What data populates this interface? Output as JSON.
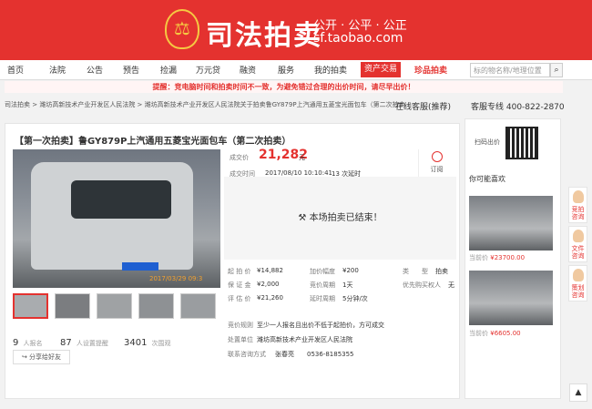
{
  "header": {
    "emblem_glyph": "⚖",
    "logo_text": "司法拍卖",
    "slogan": "公开 · 公平 · 公正",
    "url": "sf.taobao.com",
    "colors": {
      "brand_red": "#e4322f",
      "emblem_gold": "#f5c842"
    }
  },
  "nav": {
    "items": [
      "首页",
      "法院",
      "公告",
      "预告",
      "捡漏",
      "万元贷",
      "融资",
      "服务",
      "我的拍卖"
    ],
    "hot_item": "资产交易",
    "treasure_item": "珍品拍卖",
    "search_placeholder": "标的物名称/地理位置",
    "search_icon": "search-icon"
  },
  "notice": "提醒：竞电脑时间和拍卖时间不一致，为避免错过合理的出价时间，请尽早出价！",
  "breadcrumb": {
    "path": "司法拍卖 > 潍坊高新技术产业开发区人民法院 > 潍坊高新技术产业开发区人民法院关于拍卖鲁GY879P上汽通用五菱宝光面包车（第二次拍卖）（第一",
    "kefu": "在线客服(推荐)",
    "hotline": "客服专线 400-822-2870"
  },
  "item": {
    "title": "【第一次拍卖】鲁GY879P上汽通用五菱宝光面包车（第二次拍卖）",
    "photo_date": "2017/03/29 09:3",
    "price_label": "成交价",
    "price": "21,282",
    "price_unit": "元",
    "time_label": "成交时间",
    "time_value": "2017/08/10 10:10:41",
    "bids": "13 次延时",
    "remind_label": "订阅",
    "ended_text": "本场拍卖已结束！",
    "details": [
      {
        "label": "起 拍 价",
        "value": "¥14,882"
      },
      {
        "label": "加价幅度",
        "value": "¥200"
      },
      {
        "label": "类　　型",
        "value": "拍卖"
      },
      {
        "label": "保 证 金",
        "value": "¥2,000"
      },
      {
        "label": "竞价周期",
        "value": "1天"
      },
      {
        "label": "优先购买权人",
        "value": "无"
      },
      {
        "label": "评 估 价",
        "value": "¥21,260"
      },
      {
        "label": "延时周期",
        "value": "5分钟/次"
      }
    ],
    "info": [
      {
        "label": "竞价规则",
        "value": "至少一人报名且出价不低于起拍价，方可成交"
      },
      {
        "label": "处置单位",
        "value": "潍坊高新技术产业开发区人民法院"
      },
      {
        "label": "联系咨询方式",
        "value": "张春亮　　0536-8185355"
      }
    ],
    "stats": [
      {
        "num": "9",
        "label": "人报名"
      },
      {
        "num": "87",
        "label": "人设置提醒"
      },
      {
        "num": "3401",
        "label": "次围观"
      }
    ],
    "share_label": "分享给好友"
  },
  "sidebar": {
    "qr_label": "扫码出价",
    "maybe_like": "你可能喜欢",
    "recs": [
      {
        "price_label": "当前价",
        "price": "¥23700.00"
      },
      {
        "price_label": "当前价",
        "price": "¥6605.00"
      }
    ]
  },
  "floating": {
    "buttons": [
      "竞拍咨询",
      "文件咨询",
      "策划咨询"
    ],
    "back_top": "▲"
  }
}
